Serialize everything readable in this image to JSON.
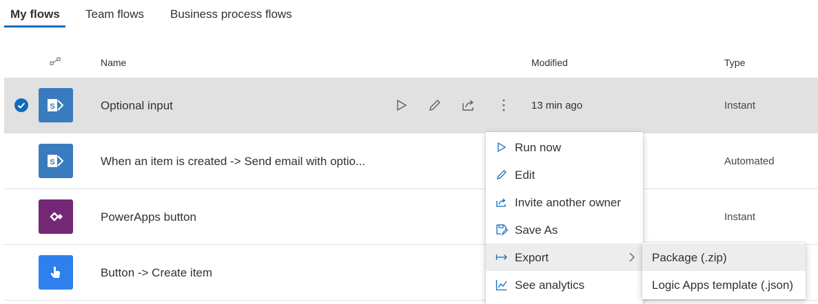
{
  "tabs": [
    {
      "label": "My flows",
      "active": true
    },
    {
      "label": "Team flows",
      "active": false
    },
    {
      "label": "Business process flows",
      "active": false
    }
  ],
  "columns": {
    "name": "Name",
    "modified": "Modified",
    "type": "Type",
    "type_icon": "flow-type-icon"
  },
  "flows": [
    {
      "name": "Optional input",
      "modified": "13 min ago",
      "type": "Instant",
      "icon": "sharepoint-icon",
      "icon_color": "#036c70",
      "selected": true
    },
    {
      "name": "When an item is created -> Send email with optio...",
      "modified": "",
      "type": "Automated",
      "icon": "sharepoint-icon",
      "icon_color": "#036c70",
      "selected": false
    },
    {
      "name": "PowerApps button",
      "modified": "",
      "type": "Instant",
      "icon": "powerapps-icon",
      "icon_color": "#742774",
      "selected": false
    },
    {
      "name": "Button -> Create item",
      "modified": "",
      "type": "",
      "icon": "touch-button-icon",
      "icon_color": "#2f80ed",
      "selected": false
    }
  ],
  "row_actions": [
    "run-icon",
    "edit-icon",
    "share-icon",
    "more-icon"
  ],
  "context_menu": {
    "items": [
      {
        "label": "Run now",
        "icon": "play-icon"
      },
      {
        "label": "Edit",
        "icon": "pencil-icon"
      },
      {
        "label": "Invite another owner",
        "icon": "share-icon"
      },
      {
        "label": "Save As",
        "icon": "save-as-icon"
      },
      {
        "label": "Export",
        "icon": "export-arrow-icon",
        "has_submenu": true,
        "hover": true
      },
      {
        "label": "See analytics",
        "icon": "analytics-icon"
      }
    ]
  },
  "export_submenu": {
    "items": [
      {
        "label": "Package (.zip)",
        "hover": true
      },
      {
        "label": "Logic Apps template (.json)",
        "hover": false
      }
    ]
  },
  "colors": {
    "accent": "#0f6cbd",
    "selected_row": "#e1e1e1",
    "menu_hover": "#ededed"
  }
}
